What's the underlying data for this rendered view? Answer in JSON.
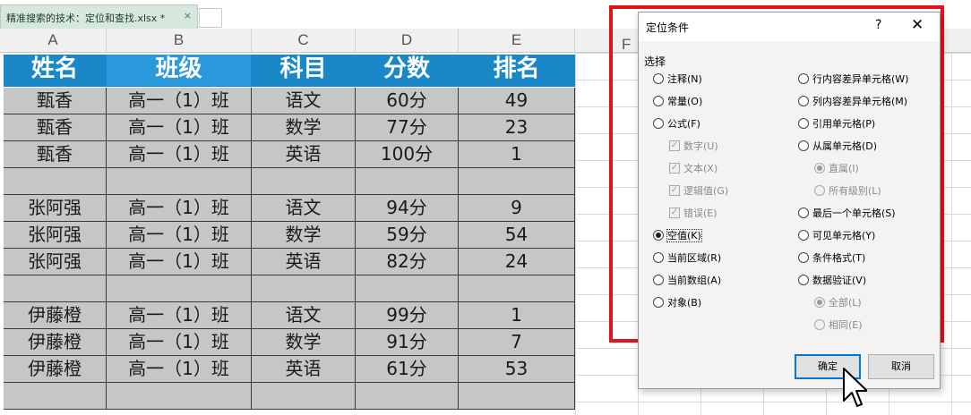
{
  "tab": {
    "title": "精准搜索的技术：定位和查找.xlsx *",
    "close": "×"
  },
  "columns": [
    "A",
    "B",
    "C",
    "D",
    "E",
    "F"
  ],
  "table": {
    "headers": [
      "姓名",
      "班级",
      "科目",
      "分数",
      "排名"
    ],
    "rows": [
      [
        "甄香",
        "高一（1）班",
        "语文",
        "60分",
        "49"
      ],
      [
        "甄香",
        "高一（1）班",
        "数学",
        "77分",
        "23"
      ],
      [
        "甄香",
        "高一（1）班",
        "英语",
        "100分",
        "1"
      ],
      [
        "",
        "",
        "",
        "",
        ""
      ],
      [
        "张阿强",
        "高一（1）班",
        "语文",
        "94分",
        "9"
      ],
      [
        "张阿强",
        "高一（1）班",
        "数学",
        "59分",
        "54"
      ],
      [
        "张阿强",
        "高一（1）班",
        "英语",
        "82分",
        "24"
      ],
      [
        "",
        "",
        "",
        "",
        ""
      ],
      [
        "伊藤橙",
        "高一（1）班",
        "语文",
        "99分",
        "1"
      ],
      [
        "伊藤橙",
        "高一（1）班",
        "数学",
        "91分",
        "7"
      ],
      [
        "伊藤橙",
        "高一（1）班",
        "英语",
        "61分",
        "53"
      ],
      [
        "",
        "",
        "",
        "",
        ""
      ]
    ]
  },
  "dialog": {
    "title": "定位条件",
    "help": "?",
    "close": "✕",
    "group_label": "选择",
    "left_options": [
      {
        "label": "注释(N)",
        "kind": "radio",
        "checked": false,
        "disabled": false
      },
      {
        "label": "常量(O)",
        "kind": "radio",
        "checked": false,
        "disabled": false
      },
      {
        "label": "公式(F)",
        "kind": "radio",
        "checked": false,
        "disabled": false
      },
      {
        "label": "数字(U)",
        "kind": "check",
        "checked": true,
        "disabled": true
      },
      {
        "label": "文本(X)",
        "kind": "check",
        "checked": true,
        "disabled": true
      },
      {
        "label": "逻辑值(G)",
        "kind": "check",
        "checked": true,
        "disabled": true
      },
      {
        "label": "错误(E)",
        "kind": "check",
        "checked": true,
        "disabled": true
      },
      {
        "label": "空值(K)",
        "kind": "radio",
        "checked": true,
        "disabled": false
      },
      {
        "label": "当前区域(R)",
        "kind": "radio",
        "checked": false,
        "disabled": false
      },
      {
        "label": "当前数组(A)",
        "kind": "radio",
        "checked": false,
        "disabled": false
      },
      {
        "label": "对象(B)",
        "kind": "radio",
        "checked": false,
        "disabled": false
      }
    ],
    "right_options": [
      {
        "label": "行内容差异单元格(W)",
        "kind": "radio",
        "checked": false,
        "disabled": false
      },
      {
        "label": "列内容差异单元格(M)",
        "kind": "radio",
        "checked": false,
        "disabled": false
      },
      {
        "label": "引用单元格(P)",
        "kind": "radio",
        "checked": false,
        "disabled": false
      },
      {
        "label": "从属单元格(D)",
        "kind": "radio",
        "checked": false,
        "disabled": false
      },
      {
        "label": "直属(I)",
        "kind": "radio",
        "checked": true,
        "disabled": true
      },
      {
        "label": "所有级别(L)",
        "kind": "radio",
        "checked": false,
        "disabled": true
      },
      {
        "label": "最后一个单元格(S)",
        "kind": "radio",
        "checked": false,
        "disabled": false
      },
      {
        "label": "可见单元格(Y)",
        "kind": "radio",
        "checked": false,
        "disabled": false
      },
      {
        "label": "条件格式(T)",
        "kind": "radio",
        "checked": false,
        "disabled": false
      },
      {
        "label": "数据验证(V)",
        "kind": "radio",
        "checked": false,
        "disabled": false
      },
      {
        "label": "全部(L)",
        "kind": "radio",
        "checked": true,
        "disabled": true
      },
      {
        "label": "相同(E)",
        "kind": "radio",
        "checked": false,
        "disabled": true
      }
    ],
    "ok_label": "确定",
    "cancel_label": "取消"
  },
  "colors": {
    "header_fill": "#1a88c8",
    "selection_fill": "#c6c6c6",
    "highlight_frame": "#e5131d",
    "tab_fill": "#d6e7de"
  }
}
